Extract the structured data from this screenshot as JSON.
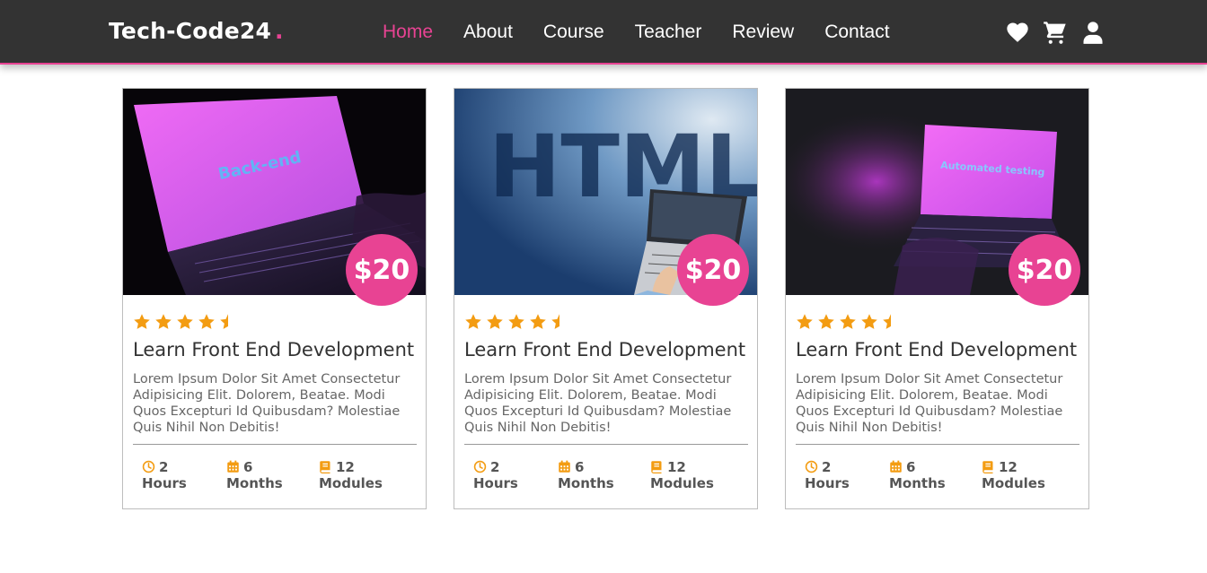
{
  "header": {
    "logo": "Tech-Code24",
    "logo_dot": ".",
    "nav": [
      "Home",
      "About",
      "Course",
      "Teacher",
      "Review",
      "Contact"
    ],
    "active_nav": "Home",
    "icons": [
      "heart-icon",
      "cart-icon",
      "user-icon"
    ]
  },
  "colors": {
    "accent": "#e84393",
    "header_bg": "#333333",
    "star": "#f39c12"
  },
  "cards": [
    {
      "image_text": "Back-end",
      "price": "$20",
      "rating": 4.5,
      "title": "Learn Front End Development",
      "description": "Lorem Ipsum Dolor Sit Amet Consectetur Adipisicing Elit. Dolorem, Beatae. Modi Quos Excepturi Id Quibusdam? Molestiae Quis Nihil Non Debitis!",
      "hours_value": "2",
      "hours_label": "Hours",
      "months_value": "6",
      "months_label": "Months",
      "modules_value": "12",
      "modules_label": "Modules"
    },
    {
      "image_text": "HTML",
      "price": "$20",
      "rating": 4.5,
      "title": "Learn Front End Development",
      "description": "Lorem Ipsum Dolor Sit Amet Consectetur Adipisicing Elit. Dolorem, Beatae. Modi Quos Excepturi Id Quibusdam? Molestiae Quis Nihil Non Debitis!",
      "hours_value": "2",
      "hours_label": "Hours",
      "months_value": "6",
      "months_label": "Months",
      "modules_value": "12",
      "modules_label": "Modules"
    },
    {
      "image_text": "Automated testing",
      "price": "$20",
      "rating": 4.5,
      "title": "Learn Front End Development",
      "description": "Lorem Ipsum Dolor Sit Amet Consectetur Adipisicing Elit. Dolorem, Beatae. Modi Quos Excepturi Id Quibusdam? Molestiae Quis Nihil Non Debitis!",
      "hours_value": "2",
      "hours_label": "Hours",
      "months_value": "6",
      "months_label": "Months",
      "modules_value": "12",
      "modules_label": "Modules"
    }
  ]
}
